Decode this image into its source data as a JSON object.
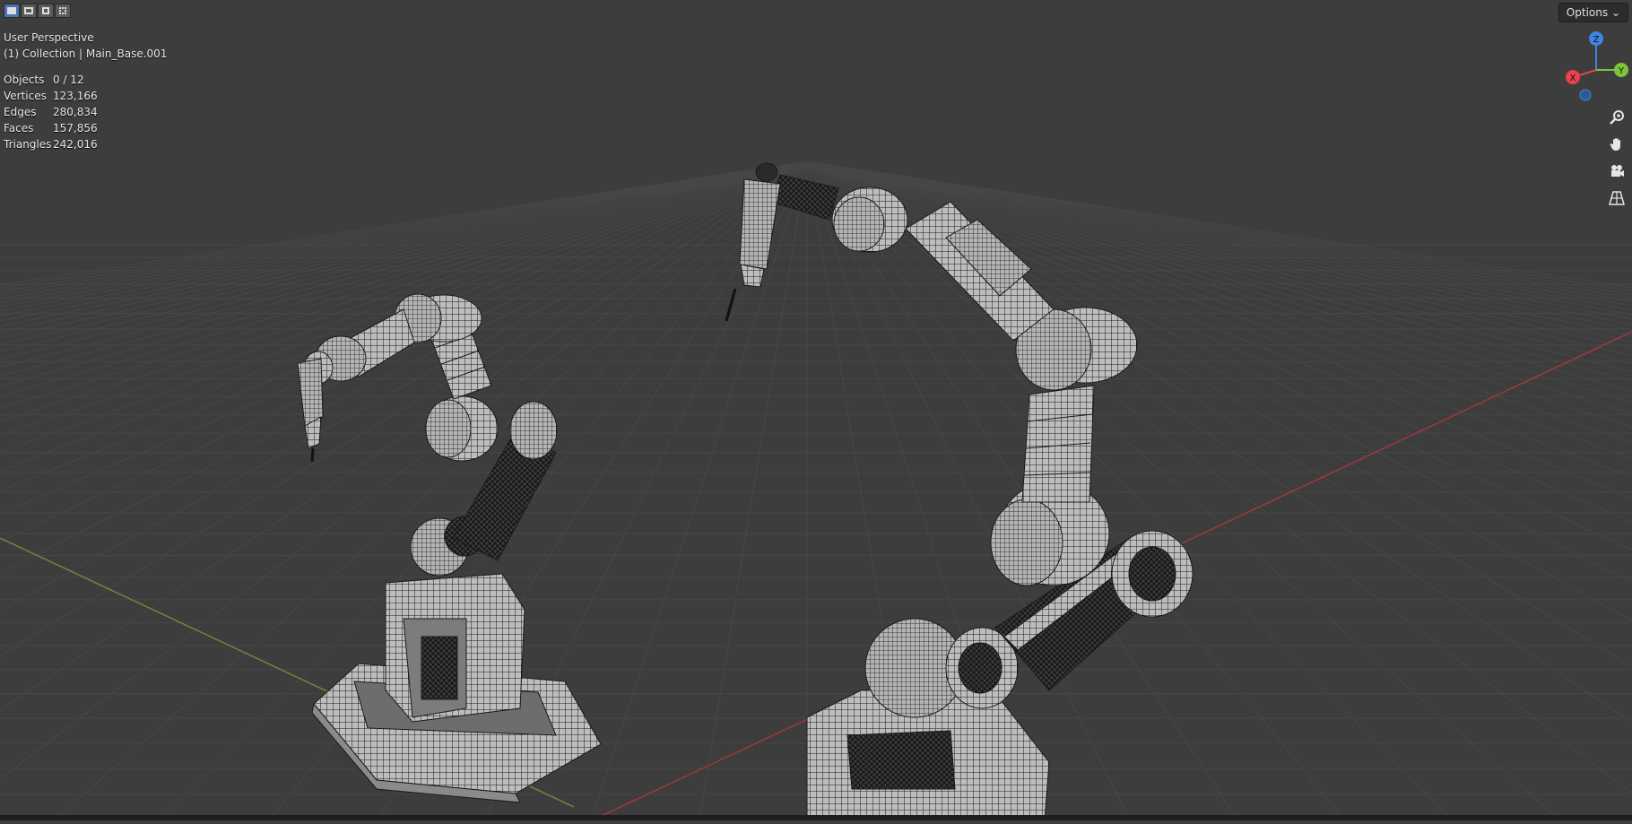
{
  "viewport": {
    "view_name": "User Perspective",
    "collection_label": "(1) Collection | Main_Base.001"
  },
  "stats": [
    {
      "label": "Objects",
      "value": "0 / 12"
    },
    {
      "label": "Vertices",
      "value": "123,166"
    },
    {
      "label": "Edges",
      "value": "280,834"
    },
    {
      "label": "Faces",
      "value": "157,856"
    },
    {
      "label": "Triangles",
      "value": "242,016"
    }
  ],
  "header": {
    "options_label": "Options"
  },
  "gizmo": {
    "x_label": "X",
    "y_label": "Y",
    "z_label": "Z"
  },
  "icons": {
    "zoom": "zoom-icon",
    "pan": "hand-icon",
    "camera": "camera-icon",
    "ortho": "grid-icon"
  },
  "colors": {
    "background": "#3d3d3d",
    "grid": "#4a4a4a",
    "x_axis": "#a0383c",
    "y_axis": "#6a8a3a",
    "gizmo_x": "#e8424e",
    "gizmo_y": "#7dc33c",
    "gizmo_z": "#3f84e0",
    "mesh": "#b9b9b9",
    "wire": "#1a1a1a",
    "accent": "#4772b3"
  }
}
